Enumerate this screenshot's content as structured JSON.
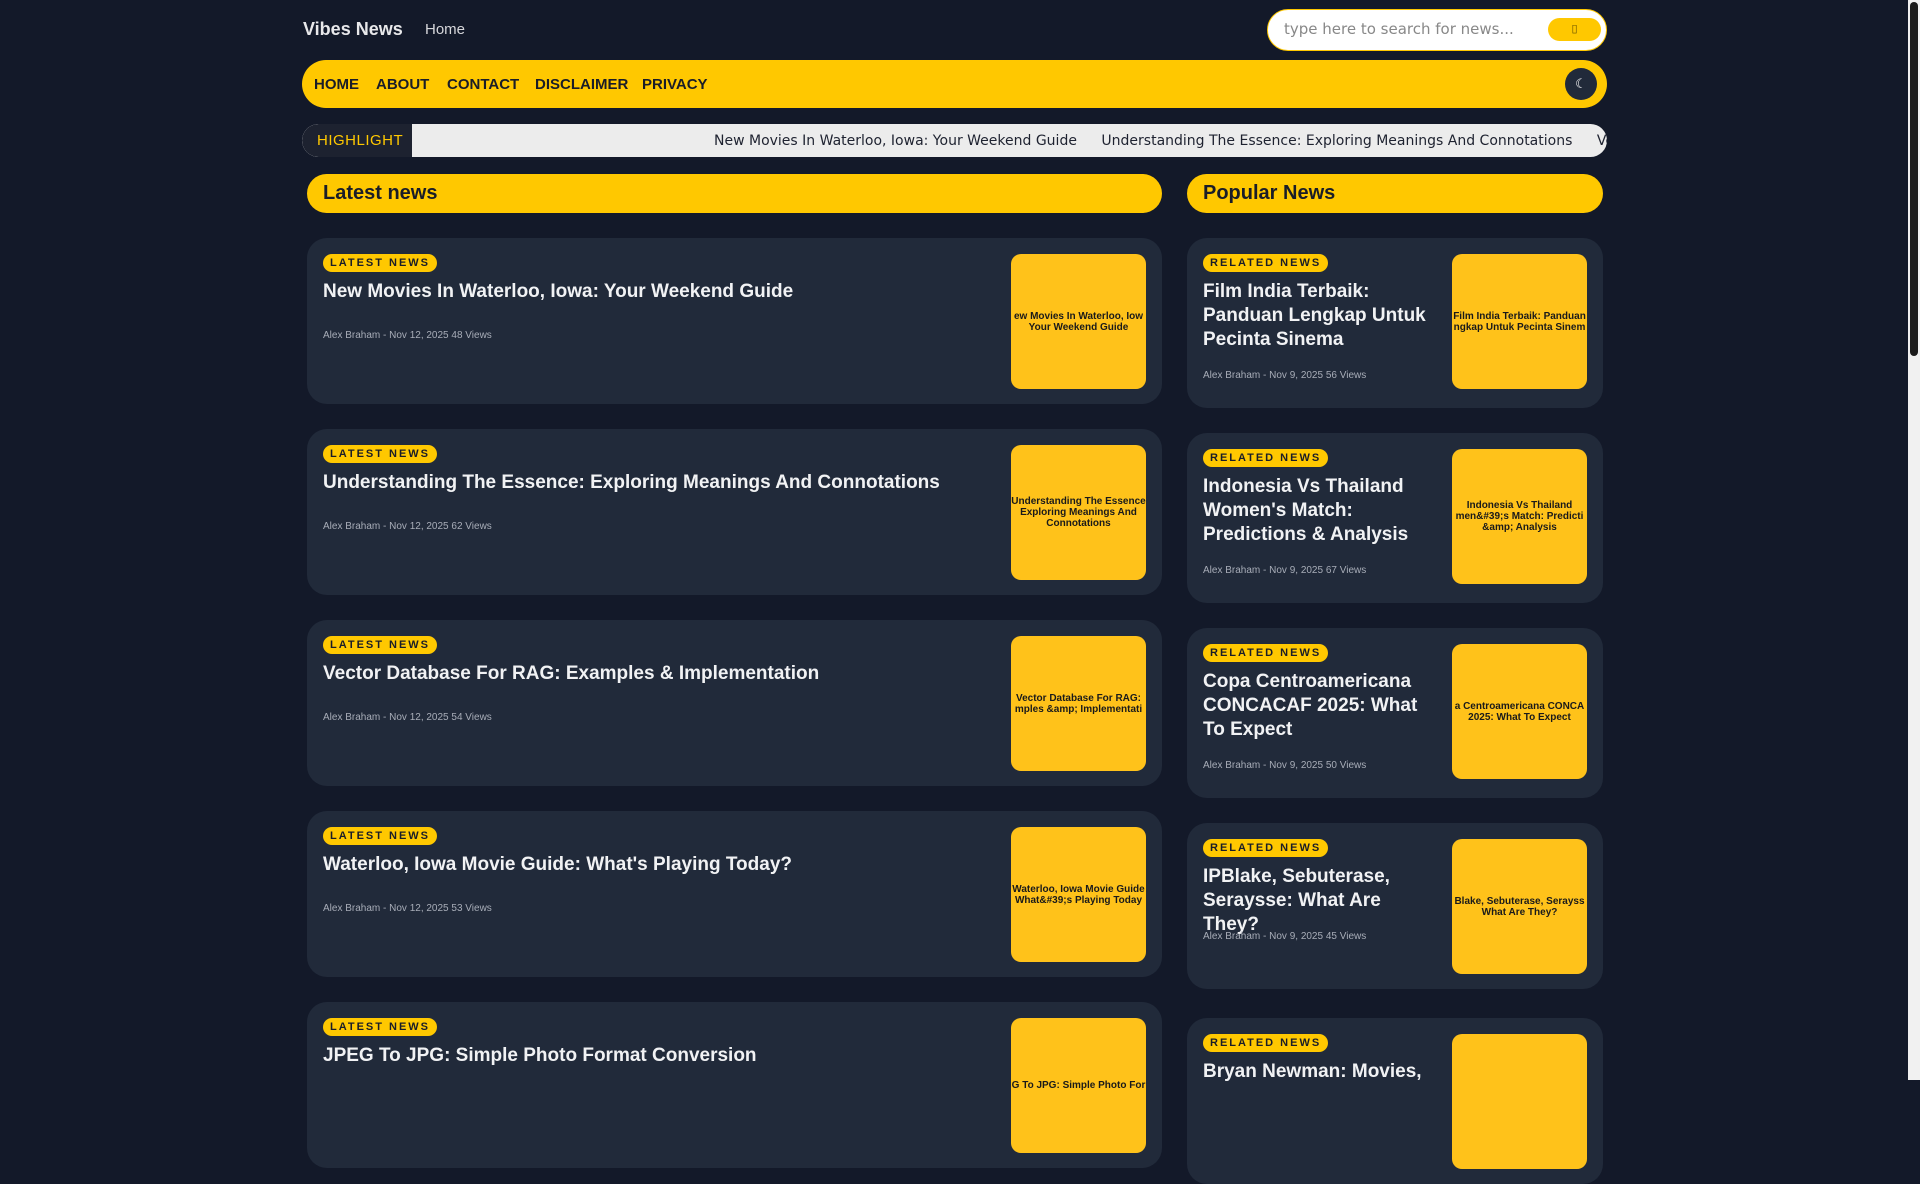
{
  "header": {
    "brand": "Vibes News",
    "home": "Home",
    "search_placeholder": "type here to search for news...",
    "search_button": "▯"
  },
  "nav": {
    "items": [
      "HOME",
      "ABOUT",
      "CONTACT",
      "DISCLAIMER",
      "PRIVACY"
    ],
    "theme_icon": "☾"
  },
  "highlight": {
    "label": "HIGHLIGHT",
    "items": [
      "New Movies In Waterloo, Iowa: Your Weekend Guide",
      "Understanding The Essence: Exploring Meanings And Connotations",
      "Vector D"
    ]
  },
  "latest": {
    "heading": "Latest news",
    "posts": [
      {
        "badge": "LATEST NEWS",
        "title": "New Movies In Waterloo, Iowa: Your Weekend Guide",
        "meta": "Alex Braham - Nov 12, 2025 48 Views",
        "thumb": "ew Movies In Waterloo, Iow\nYour Weekend Guide"
      },
      {
        "badge": "LATEST NEWS",
        "title": "Understanding The Essence: Exploring Meanings And Connotations",
        "meta": "Alex Braham - Nov 12, 2025 62 Views",
        "thumb": "Understanding The Essence\nExploring Meanings And\nConnotations"
      },
      {
        "badge": "LATEST NEWS",
        "title": "Vector Database For RAG: Examples & Implementation",
        "meta": "Alex Braham - Nov 12, 2025 54 Views",
        "thumb": "Vector Database For RAG:\nmples &amp; Implementati"
      },
      {
        "badge": "LATEST NEWS",
        "title": "Waterloo, Iowa Movie Guide: What's Playing Today?",
        "meta": "Alex Braham - Nov 12, 2025 53 Views",
        "thumb": "Waterloo, Iowa Movie Guide\nWhat&#39;s Playing Today"
      },
      {
        "badge": "LATEST NEWS",
        "title": "JPEG To JPG: Simple Photo Format Conversion",
        "meta": "",
        "thumb": "G To JPG: Simple Photo For"
      }
    ]
  },
  "popular": {
    "heading": "Popular News",
    "posts": [
      {
        "badge": "RELATED NEWS",
        "title": "Film India Terbaik: Panduan Lengkap Untuk Pecinta Sinema",
        "meta": "Alex Braham - Nov 9, 2025 56 Views",
        "thumb": "Film India Terbaik: Panduan\nngkap Untuk Pecinta Sinem"
      },
      {
        "badge": "RELATED NEWS",
        "title": "Indonesia Vs Thailand Women's Match: Predictions & Analysis",
        "meta": "Alex Braham - Nov 9, 2025 67 Views",
        "thumb": "Indonesia Vs Thailand\nmen&#39;s Match: Predicti\n&amp; Analysis"
      },
      {
        "badge": "RELATED NEWS",
        "title": "Copa Centroamericana CONCACAF 2025: What To Expect",
        "meta": "Alex Braham - Nov 9, 2025 50 Views",
        "thumb": "a Centroamericana CONCA\n2025: What To Expect"
      },
      {
        "badge": "RELATED NEWS",
        "title": "IPBlake, Sebuterase, Seraysse: What Are They?",
        "meta": "Alex Braham - Nov 9, 2025 45 Views",
        "thumb": "Blake, Sebuterase, Serayss\nWhat Are They?"
      },
      {
        "badge": "RELATED NEWS",
        "title": "Bryan Newman: Movies,",
        "meta": "",
        "thumb": ""
      }
    ]
  }
}
